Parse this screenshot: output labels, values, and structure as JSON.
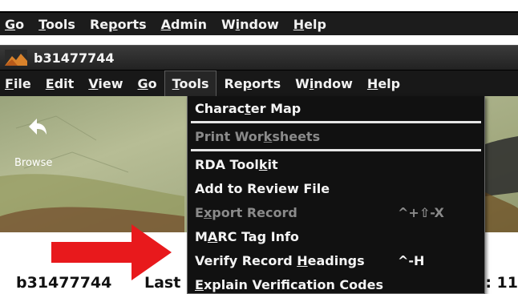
{
  "outer_menu": {
    "items": [
      {
        "label": "Go",
        "mnemonic": "G",
        "rest": "o"
      },
      {
        "label": "Tools",
        "mnemonic": "T",
        "rest": "ools"
      },
      {
        "label": "Reports",
        "pre": "Re",
        "mnemonic": "p",
        "rest": "orts"
      },
      {
        "label": "Admin",
        "mnemonic": "A",
        "rest": "dmin"
      },
      {
        "label": "Window",
        "pre": "W",
        "mnemonic": "i",
        "rest": "ndow"
      },
      {
        "label": "Help",
        "mnemonic": "H",
        "rest": "elp"
      }
    ]
  },
  "window": {
    "title": "b31477744",
    "icon": "mountain-logo-icon"
  },
  "inner_menu": {
    "items": [
      {
        "label": "File",
        "mnemonic": "F",
        "rest": "ile"
      },
      {
        "label": "Edit",
        "mnemonic": "E",
        "rest": "dit"
      },
      {
        "label": "View",
        "mnemonic": "V",
        "rest": "iew"
      },
      {
        "label": "Go",
        "mnemonic": "G",
        "rest": "o"
      },
      {
        "label": "Tools",
        "mnemonic": "T",
        "rest": "ools",
        "active": true
      },
      {
        "label": "Reports",
        "pre": "Re",
        "mnemonic": "p",
        "rest": "orts"
      },
      {
        "label": "Window",
        "pre": "W",
        "mnemonic": "i",
        "rest": "ndow"
      },
      {
        "label": "Help",
        "mnemonic": "H",
        "rest": "elp"
      }
    ]
  },
  "toolbar": {
    "browse_label": "Browse",
    "browse_icon": "back-arrow-icon"
  },
  "tools_menu": {
    "items": [
      {
        "label": "Character Map",
        "pre": "Charac",
        "mnemonic": "t",
        "rest": "er Map",
        "shortcut": "",
        "disabled": false
      },
      {
        "separator": true
      },
      {
        "label": "Print Worksheets",
        "pre": "Print Wor",
        "mnemonic": "k",
        "rest": "sheets",
        "shortcut": "",
        "disabled": true
      },
      {
        "separator": true
      },
      {
        "label": "RDA Toolkit",
        "pre": "RDA Tool",
        "mnemonic": "k",
        "rest": "it",
        "shortcut": "",
        "disabled": false
      },
      {
        "label": "Add to Review File",
        "pre": "",
        "mnemonic": "",
        "rest": "Add to Review File",
        "shortcut": "",
        "disabled": false
      },
      {
        "label": "Export Record",
        "pre": "E",
        "mnemonic": "x",
        "rest": "port Record",
        "shortcut": "^+⇧-X",
        "disabled": true
      },
      {
        "label": "MARC Tag Info",
        "pre": "M",
        "mnemonic": "A",
        "rest": "RC Tag Info",
        "shortcut": "",
        "disabled": false
      },
      {
        "label": "Verify Record Headings",
        "pre": "Verify Record ",
        "mnemonic": "H",
        "rest": "eadings",
        "shortcut": "^-H",
        "disabled": false
      },
      {
        "label": "Explain Verification Codes",
        "pre": "",
        "mnemonic": "E",
        "rest": "xplain Verification Codes",
        "shortcut": "",
        "disabled": false
      }
    ]
  },
  "record": {
    "id": "b31477744",
    "last_fragment": "Last",
    "right_fragment": "d: 11"
  },
  "annotation": {
    "arrow_color": "#e8191c"
  }
}
